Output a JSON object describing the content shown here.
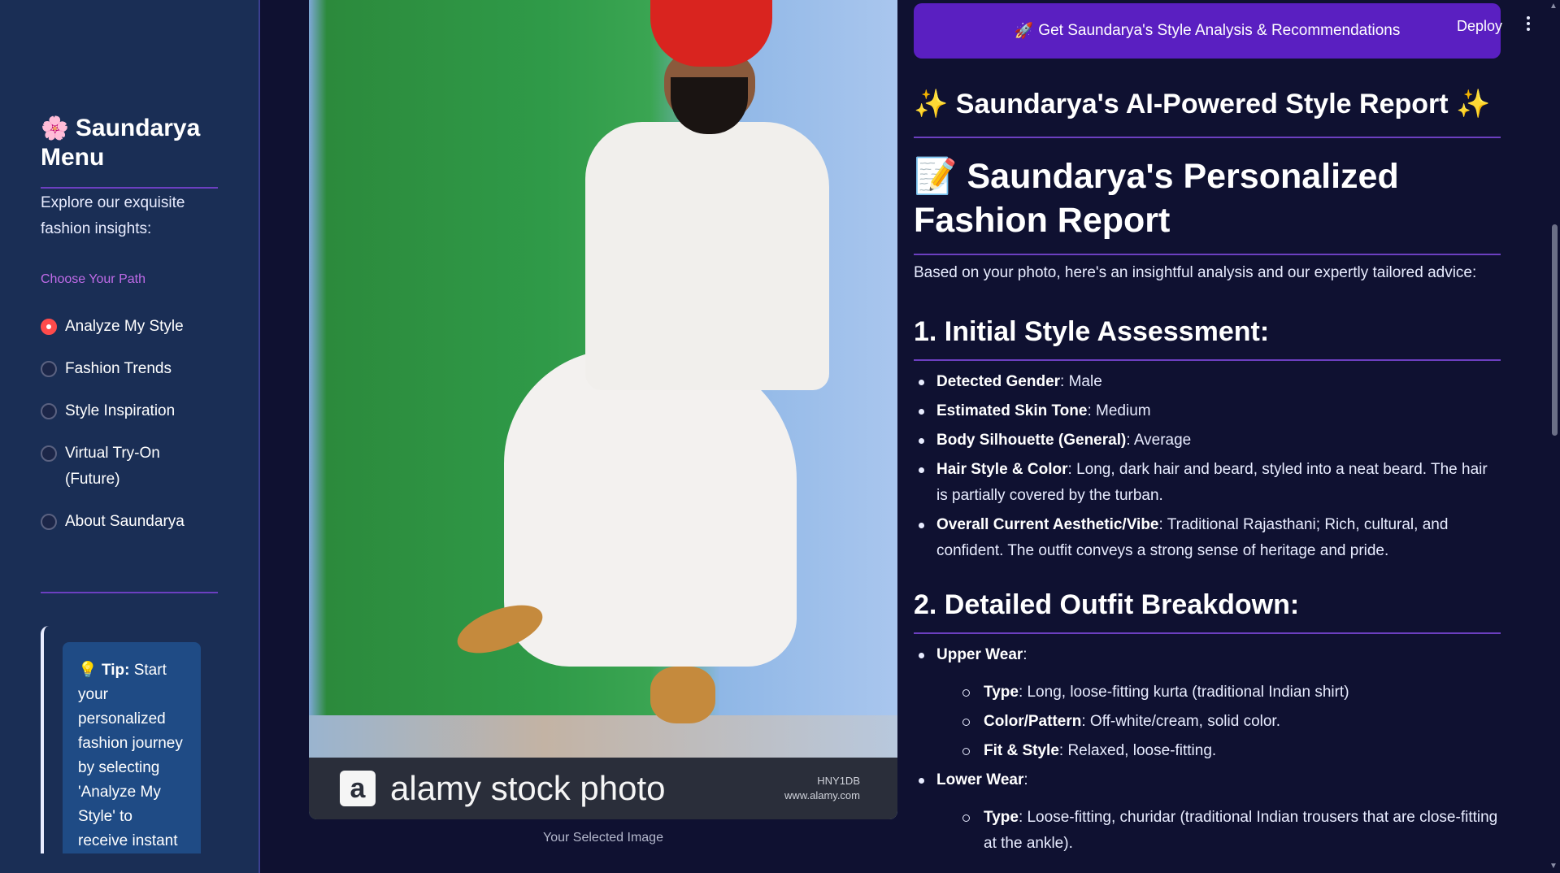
{
  "sidebar": {
    "title_icon": "flower-icon",
    "title": "Saundarya Menu",
    "description": "Explore our exquisite fashion insights:",
    "choose_label": "Choose Your Path",
    "options": [
      {
        "label": "Analyze My Style",
        "selected": true
      },
      {
        "label": "Fashion Trends",
        "selected": false
      },
      {
        "label": "Style Inspiration",
        "selected": false
      },
      {
        "label": "Virtual Try-On (Future)",
        "selected": false
      },
      {
        "label": "About Saundarya",
        "selected": false
      }
    ],
    "tip": {
      "icon": "lightbulb-icon",
      "label": "Tip:",
      "text": "Start your personalized fashion journey by selecting 'Analyze My Style' to receive instant"
    }
  },
  "image": {
    "watermark_logo": "a",
    "watermark_text": "alamy stock photo",
    "watermark_id": "HNY1DB",
    "watermark_url": "www.alamy.com",
    "caption": "Your Selected Image"
  },
  "header": {
    "cta_icon": "rocket-icon",
    "cta_label": "Get Saundarya's Style Analysis & Recommendations",
    "deploy_label": "Deploy"
  },
  "report": {
    "title_icon": "sparkles-icon",
    "title": "Saundarya's AI-Powered Style Report",
    "personal_icon": "memo-icon",
    "personal_title": "Saundarya's Personalized Fashion Report",
    "intro": "Based on your photo, here's an insightful analysis and our expertly tailored advice:",
    "section1": {
      "heading": "1. Initial Style Assessment:",
      "items": [
        {
          "key": "Detected Gender",
          "value": ": Male"
        },
        {
          "key": "Estimated Skin Tone",
          "value": ": Medium"
        },
        {
          "key": "Body Silhouette (General)",
          "value": ": Average"
        },
        {
          "key": "Hair Style & Color",
          "value": ": Long, dark hair and beard, styled into a neat beard. The hair is partially covered by the turban."
        },
        {
          "key": "Overall Current Aesthetic/Vibe",
          "value": ": Traditional Rajasthani; Rich, cultural, and confident. The outfit conveys a strong sense of heritage and pride."
        }
      ]
    },
    "section2": {
      "heading": "2. Detailed Outfit Breakdown:",
      "upper_label": "Upper Wear",
      "upper": [
        {
          "key": "Type",
          "value": ": Long, loose-fitting kurta (traditional Indian shirt)"
        },
        {
          "key": "Color/Pattern",
          "value": ": Off-white/cream, solid color."
        },
        {
          "key": "Fit & Style",
          "value": ": Relaxed, loose-fitting."
        }
      ],
      "lower_label": "Lower Wear",
      "lower": [
        {
          "key": "Type",
          "value": ": Loose-fitting, churidar (traditional Indian trousers that are close-fitting at the ankle)."
        }
      ]
    }
  }
}
